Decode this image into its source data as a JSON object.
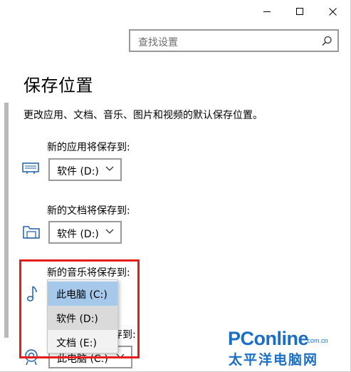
{
  "window": {
    "controls": {
      "minimize_icon": "minimize-icon",
      "maximize_icon": "maximize-icon",
      "close_icon": "close-icon"
    }
  },
  "search": {
    "placeholder": "查找设置",
    "icon": "search-icon"
  },
  "page": {
    "title": "保存位置",
    "description": "更改应用、文档、音乐、图片和视频的默认保存位置。"
  },
  "groups": [
    {
      "label": "新的应用将保存到:",
      "value": "软件 (D:)",
      "icon": "monitor-icon"
    },
    {
      "label": "新的文档将保存到:",
      "value": "软件 (D:)",
      "icon": "folder-icon"
    },
    {
      "label": "新的音乐将保存到:",
      "icon": "music-note-icon"
    },
    {
      "label_tail": "存到:",
      "value_partial": "此电脑 (C:)",
      "icon": "camera-icon"
    }
  ],
  "music_dropdown": {
    "options": [
      "此电脑 (C:)",
      "软件 (D:)",
      "文档 (E:)"
    ],
    "selected": "此电脑 (C:)"
  },
  "annotation": {
    "color": "#e41d1d"
  },
  "watermark": {
    "brand_prefix": "PC",
    "brand_suffix": "online",
    "domain_suffix": ".com.cn",
    "chinese": "太平洋电脑网",
    "color": "#1a6ec4"
  }
}
